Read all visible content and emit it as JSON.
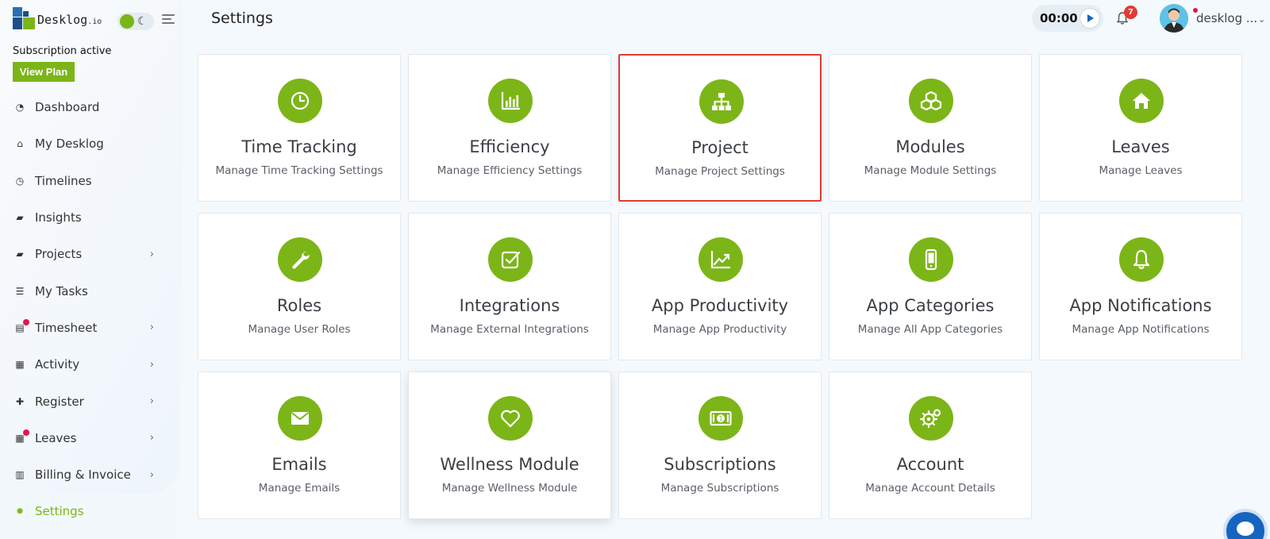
{
  "app": {
    "logo_text": "Desklog",
    "logo_suffix": ".io"
  },
  "sidebar": {
    "subscription_status": "Subscription active",
    "view_plan_label": "View Plan",
    "items": [
      {
        "label": "Dashboard",
        "icon": "dashboard-icon",
        "chevron": false,
        "dot": false
      },
      {
        "label": "My Desklog",
        "icon": "home-icon",
        "chevron": false,
        "dot": false
      },
      {
        "label": "Timelines",
        "icon": "clock-icon",
        "chevron": false,
        "dot": false
      },
      {
        "label": "Insights",
        "icon": "book-icon",
        "chevron": false,
        "dot": false
      },
      {
        "label": "Projects",
        "icon": "book-icon",
        "chevron": true,
        "dot": false
      },
      {
        "label": "My Tasks",
        "icon": "tasks-icon",
        "chevron": false,
        "dot": false
      },
      {
        "label": "Timesheet",
        "icon": "sheet-icon",
        "chevron": true,
        "dot": true
      },
      {
        "label": "Activity",
        "icon": "grid-icon",
        "chevron": true,
        "dot": false
      },
      {
        "label": "Register",
        "icon": "plus-icon",
        "chevron": true,
        "dot": false
      },
      {
        "label": "Leaves",
        "icon": "calendar-icon",
        "chevron": true,
        "dot": true
      },
      {
        "label": "Billing & Invoice",
        "icon": "invoice-icon",
        "chevron": true,
        "dot": false
      },
      {
        "label": "Settings",
        "icon": "gear-icon",
        "chevron": false,
        "dot": false,
        "active": true
      }
    ]
  },
  "header": {
    "title": "Settings",
    "timer": "00:00",
    "notification_count": "7",
    "user_name": "desklog ..."
  },
  "cards": [
    {
      "title": "Time Tracking",
      "desc": "Manage Time Tracking Settings",
      "icon": "clock-icon"
    },
    {
      "title": "Efficiency",
      "desc": "Manage Efficiency Settings",
      "icon": "bar-chart-icon"
    },
    {
      "title": "Project",
      "desc": "Manage Project Settings",
      "icon": "sitemap-icon",
      "highlight": true
    },
    {
      "title": "Modules",
      "desc": "Manage Module Settings",
      "icon": "cubes-icon"
    },
    {
      "title": "Leaves",
      "desc": "Manage Leaves",
      "icon": "home-icon"
    },
    {
      "title": "Roles",
      "desc": "Manage User Roles",
      "icon": "wrench-icon"
    },
    {
      "title": "Integrations",
      "desc": "Manage External Integrations",
      "icon": "check-square-icon"
    },
    {
      "title": "App Productivity",
      "desc": "Manage App Productivity",
      "icon": "line-chart-icon"
    },
    {
      "title": "App Categories",
      "desc": "Manage All App Categories",
      "icon": "mobile-icon"
    },
    {
      "title": "App Notifications",
      "desc": "Manage App Notifications",
      "icon": "bell-icon"
    },
    {
      "title": "Emails",
      "desc": "Manage Emails",
      "icon": "envelope-icon"
    },
    {
      "title": "Wellness Module",
      "desc": "Manage Wellness Module",
      "icon": "heart-icon",
      "raised": true
    },
    {
      "title": "Subscriptions",
      "desc": "Manage Subscriptions",
      "icon": "money-icon"
    },
    {
      "title": "Account",
      "desc": "Manage Account Details",
      "icon": "gears-icon"
    }
  ],
  "colors": {
    "accent": "#7cb518",
    "highlight_border": "#e53935",
    "badge": "#e53935"
  }
}
